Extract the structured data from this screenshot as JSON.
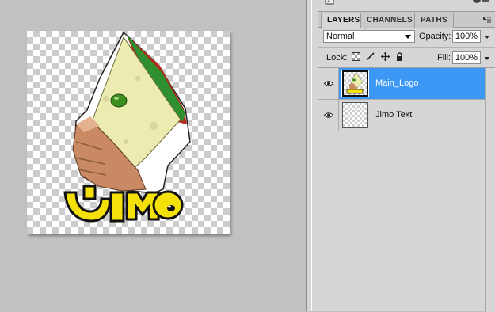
{
  "layers_panel": {
    "tabs": [
      {
        "label": "LAYERS",
        "active": true
      },
      {
        "label": "CHANNELS",
        "active": false
      },
      {
        "label": "PATHS",
        "active": false
      }
    ],
    "blend_mode": "Normal",
    "opacity_label": "Opacity:",
    "opacity_value": "100%",
    "lock_label": "Lock:",
    "fill_label": "Fill:",
    "fill_value": "100%",
    "layers": [
      {
        "name": "Main_Logo",
        "visible": true,
        "selected": true
      },
      {
        "name": "Jimo Text",
        "visible": true,
        "selected": false
      }
    ]
  },
  "canvas": {
    "artwork_text": "Jimo"
  },
  "colors": {
    "canvas_background": "#c1c1c1",
    "panel_background": "#d6d6d6",
    "selection_blue": "#3d97f5",
    "logo_yellow": "#f5e10a"
  },
  "icons": [
    "panel-menu-icon",
    "eye-icon",
    "lock-transparent-icon",
    "lock-image-icon",
    "lock-position-icon",
    "lock-all-icon"
  ]
}
